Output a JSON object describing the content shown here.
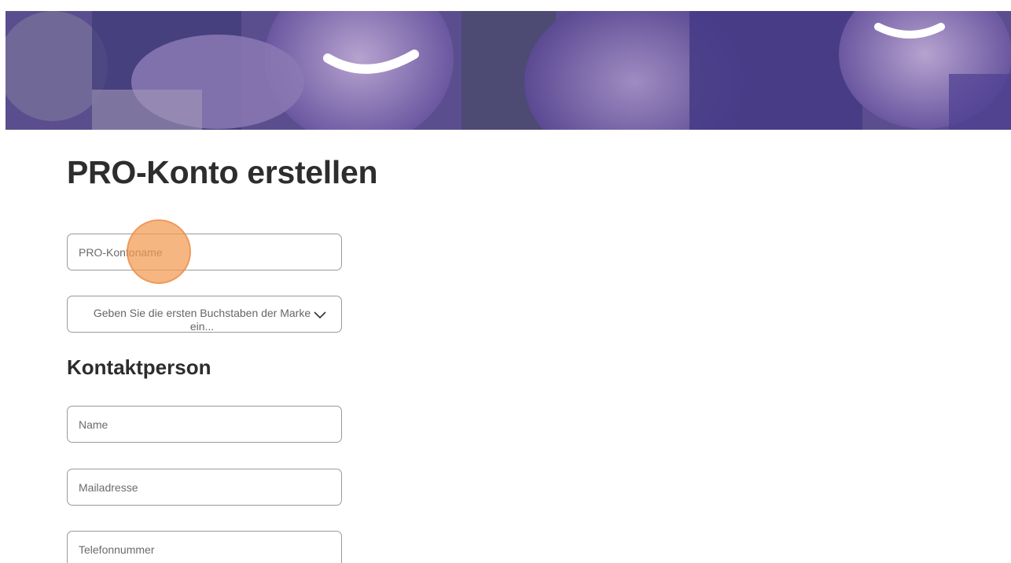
{
  "header": {
    "banner_image": "family-photo-banner"
  },
  "form": {
    "title": "PRO-Konto erstellen",
    "account_name": {
      "placeholder": "PRO-Kontoname",
      "value": ""
    },
    "brand_select": {
      "placeholder": "Geben Sie die ersten Buchstaben der Marke ein...",
      "icon": "chevron-down-icon"
    },
    "contact_heading": "Kontaktperson",
    "contact_name": {
      "placeholder": "Name",
      "value": ""
    },
    "contact_email": {
      "placeholder": "Mailadresse",
      "value": ""
    },
    "contact_phone": {
      "placeholder": "Telefonnummer",
      "value": ""
    }
  },
  "colors": {
    "banner_tint": "#5a4b95",
    "click_marker": "#f39a52",
    "field_border": "#9a9a9a"
  }
}
